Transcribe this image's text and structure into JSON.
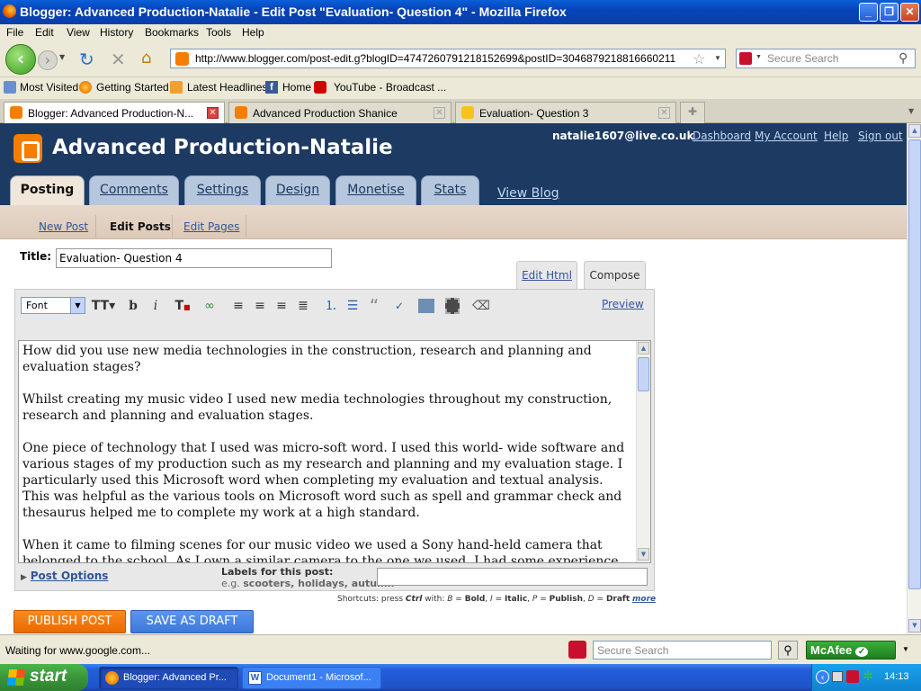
{
  "window": {
    "title": "Blogger: Advanced Production-Natalie - Edit Post \"Evaluation- Question 4\" - Mozilla Firefox"
  },
  "menu": [
    "File",
    "Edit",
    "View",
    "History",
    "Bookmarks",
    "Tools",
    "Help"
  ],
  "nav": {
    "url": "http://www.blogger.com/post-edit.g?blogID=4747260791218152699&postID=3046879218816660211",
    "search_placeholder": "Secure Search"
  },
  "bookmarks": [
    "Most Visited",
    "Getting Started",
    "Latest Headlines",
    "Home",
    "YouTube - Broadcast ..."
  ],
  "tabs": [
    {
      "label": "Blogger: Advanced Production-N..."
    },
    {
      "label": "Advanced Production Shanice"
    },
    {
      "label": "Evaluation- Question 3"
    }
  ],
  "header": {
    "blog_name": "Advanced Production-Natalie",
    "email": "natalie1607@live.co.uk",
    "links": [
      "Dashboard",
      "My Account",
      "Help",
      "Sign out"
    ],
    "main_tabs": [
      "Posting",
      "Comments",
      "Settings",
      "Design",
      "Monetise",
      "Stats"
    ],
    "view_blog": "View Blog"
  },
  "subnav": {
    "new_post": "New Post",
    "edit_posts": "Edit Posts",
    "edit_pages": "Edit Pages"
  },
  "post": {
    "title_label": "Title:",
    "title_value": "Evaluation- Question 4",
    "edit_html": "Edit Html",
    "compose": "Compose",
    "font_label": "Font",
    "preview": "Preview",
    "body": [
      "How did you use new media technologies in the construction, research and planning and evaluation stages?",
      "Whilst creating my music video I used new media technologies throughout my construction, research and planning and evaluation stages.",
      "One piece of technology that I used was micro-soft word. I used this world- wide software and various stages of my production such as my research and planning and my evaluation stage. I particularly used this Microsoft word when completing my evaluation and textual analysis. This was helpful as the various tools on Microsoft word such as spell and grammar check and thesaurus helped me to complete my work at a high standard.",
      "When it came to filming scenes for our music video we used a Sony hand-held camera that belonged to the school. As I own a similar camera to the one we used, I had some experience"
    ],
    "post_options": "Post Options",
    "labels_label": "Labels for this post:",
    "labels_hint_prefix": "e.g.",
    "labels_hint": "scooters, holidays, autumn",
    "shortcuts": {
      "prefix": "Shortcuts: press",
      "ctrl": "Ctrl",
      "with": "with:",
      "b_key": "B",
      "b_desc": "Bold",
      "i_key": "I",
      "i_desc": "Italic",
      "p_key": "P",
      "p_desc": "Publish",
      "d_key": "D",
      "d_desc": "Draft",
      "more": "more"
    },
    "publish": "PUBLISH POST",
    "save_draft": "SAVE AS DRAFT"
  },
  "status": {
    "text": "Waiting for www.google.com...",
    "search_placeholder": "Secure Search",
    "mcafee": "McAfee"
  },
  "taskbar": {
    "start": "start",
    "tasks": [
      "Blogger: Advanced Pr...",
      "Document1 - Microsof..."
    ],
    "clock": "14:13"
  },
  "colors": {
    "blogger_orange": "#f57d00",
    "header_navy": "#1d3a63",
    "save_blue": "#4a86e8"
  }
}
